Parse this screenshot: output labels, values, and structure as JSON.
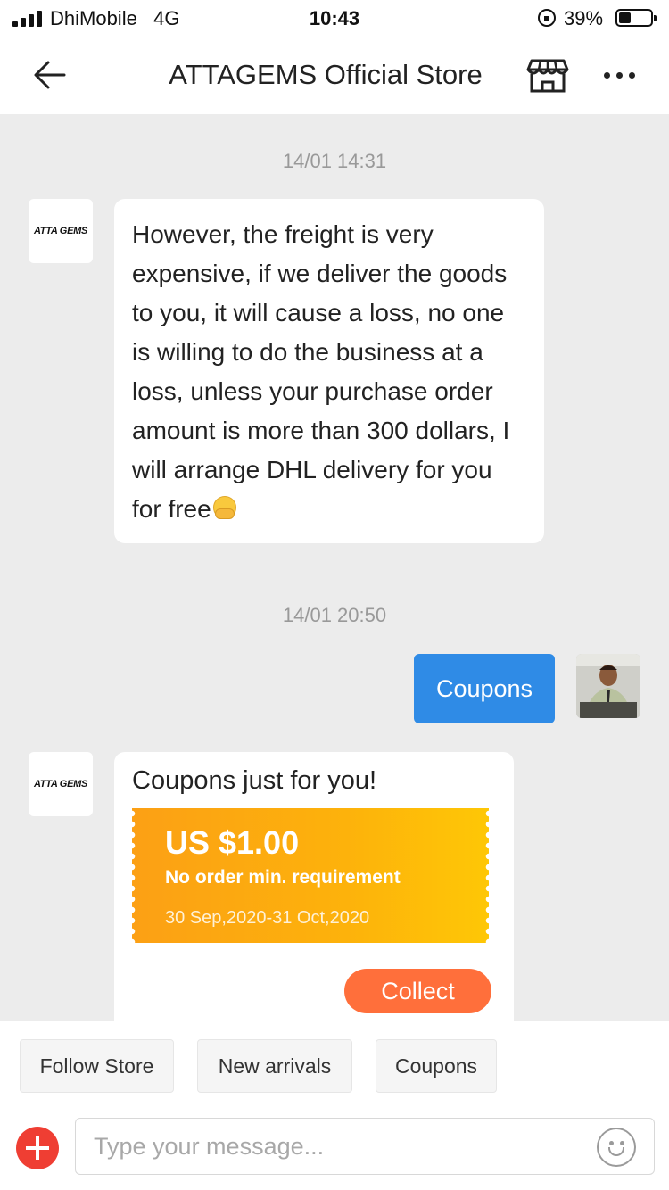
{
  "status_bar": {
    "carrier": "DhiMobile",
    "network": "4G",
    "time": "10:43",
    "battery_percent": "39%",
    "battery_level": 0.39
  },
  "header": {
    "title": "ATTAGEMS Official Store",
    "back_icon": "back-arrow-icon",
    "store_icon": "storefront-icon",
    "more_icon": "more-dots-icon"
  },
  "chat": {
    "store_logo_text": "ATTA GEMS",
    "messages": [
      {
        "timestamp": "14/01 14:31",
        "sender": "store",
        "text": "However, the freight is very expensive, if we deliver the goods to you, it will cause a loss, no one is willing to do the business at a loss, unless your purchase order amount is more than 300 dollars, I will arrange DHL delivery for you for free",
        "emoji": "hugging-face-icon"
      },
      {
        "timestamp": "14/01 20:50",
        "sender": "user",
        "text": "Coupons"
      },
      {
        "sender": "store",
        "title": "Coupons just for you!",
        "coupon": {
          "amount": "US $1.00",
          "requirement": "No order min. requirement",
          "dates": "30 Sep,2020-31 Oct,2020",
          "colors": [
            "#fca015",
            "#fec706"
          ]
        },
        "action_label": "Collect"
      }
    ]
  },
  "quick_replies": [
    "Follow Store",
    "New arrivals",
    "Coupons"
  ],
  "input": {
    "placeholder": "Type your message...",
    "value": ""
  },
  "colors": {
    "accent_blue": "#2f8be6",
    "collect_orange": "#ff6f3b",
    "plus_red": "#ef3e33"
  }
}
